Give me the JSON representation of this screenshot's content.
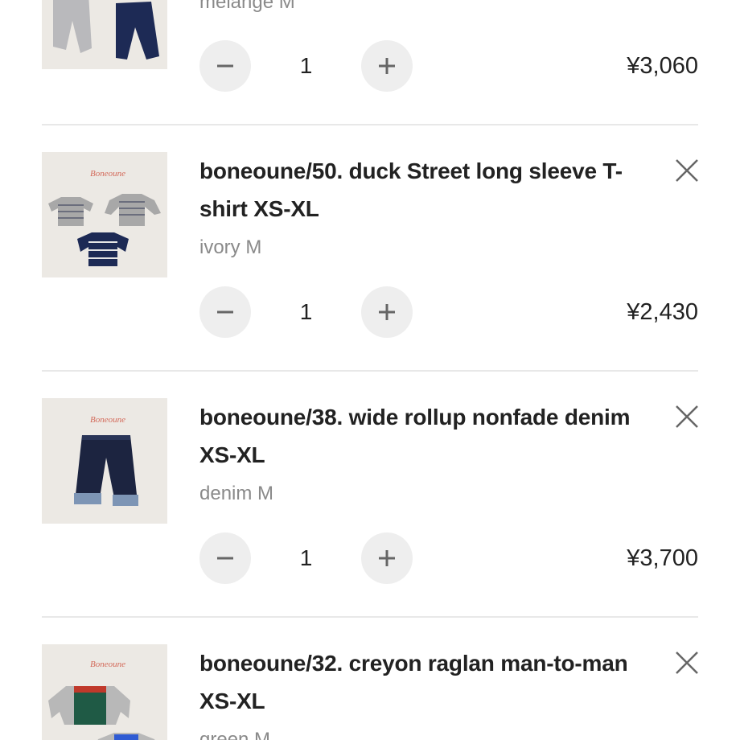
{
  "cart": {
    "items": [
      {
        "name": "",
        "variant": "melange M",
        "quantity": "1",
        "price": "¥3,060",
        "image_icon": "pants-product-image"
      },
      {
        "name": "boneoune/50. duck Street long sleeve T-shirt XS-XL",
        "name_line1": "boneoune/50. duck Street long sleeve T-",
        "name_line2": "shirt XS-XL",
        "variant": "ivory M",
        "quantity": "1",
        "price": "¥2,430",
        "image_icon": "tshirt-product-image"
      },
      {
        "name": "boneoune/38. wide rollup nonfade denim XS-XL",
        "name_line1": "boneoune/38. wide rollup nonfade denim",
        "name_line2": "XS-XL",
        "variant": "denim M",
        "quantity": "1",
        "price": "¥3,700",
        "image_icon": "denim-product-image"
      },
      {
        "name": "boneoune/32. creyon raglan man-to-man XS-XL",
        "name_line1": "boneoune/32. creyon raglan man-to-man",
        "name_line2": "XS-XL",
        "variant": "green M",
        "image_icon": "sweatshirt-product-image"
      }
    ]
  },
  "icons": {
    "minus": "minus-icon",
    "plus": "plus-icon",
    "remove": "close-icon"
  },
  "colors": {
    "text": "#222222",
    "muted": "#8a8a8a",
    "button_bg": "#eeeeee",
    "divider": "#e8e8e8",
    "thumb_bg": "#ece9e4"
  }
}
